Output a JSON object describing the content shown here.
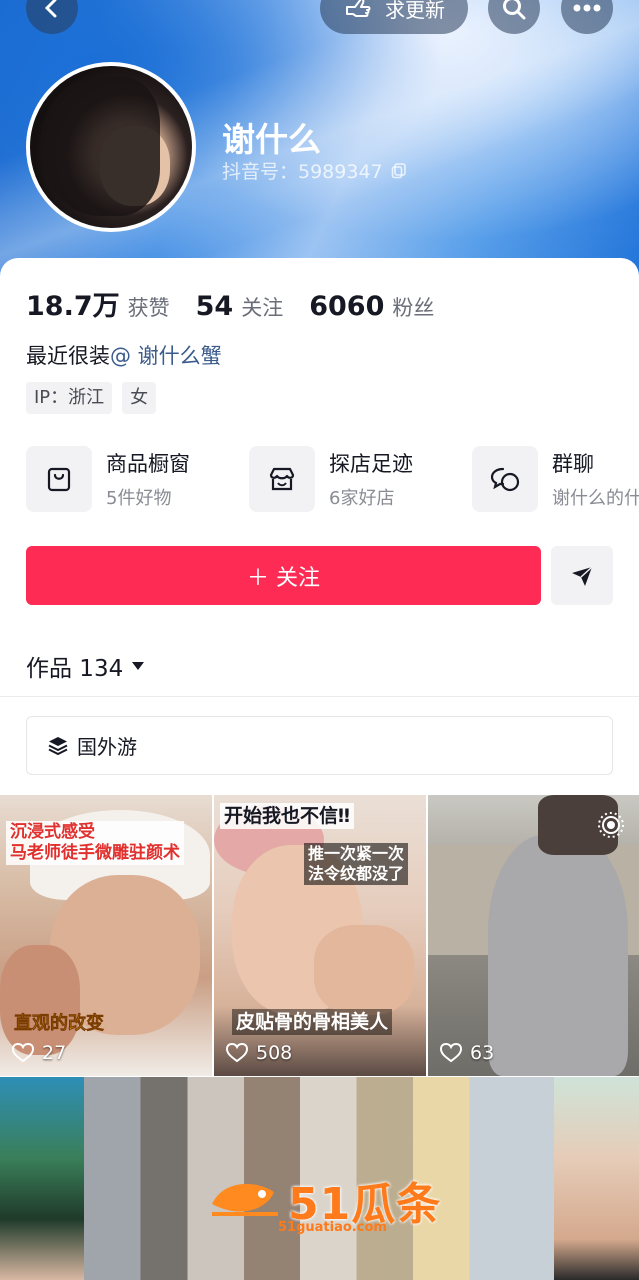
{
  "header": {
    "update_label": "求更新",
    "icons": [
      "back-arrow-icon",
      "hand-point-icon",
      "search-icon",
      "more-icon"
    ]
  },
  "profile": {
    "name": "谢什么",
    "douyin_id": "抖音号：5989347"
  },
  "stats": [
    {
      "value": "18.7万",
      "label": "获赞"
    },
    {
      "value": "54",
      "label": "关注"
    },
    {
      "value": "6060",
      "label": "粉丝"
    }
  ],
  "bio": {
    "text": "最近很装",
    "mention": "@ 谢什么蟹"
  },
  "tags": [
    "IP：浙江",
    "女"
  ],
  "features": [
    {
      "title": "商品橱窗",
      "subtitle": "5件好物"
    },
    {
      "title": "探店足迹",
      "subtitle": "6家好店"
    },
    {
      "title": "群聊",
      "subtitle": "谢什么的什"
    }
  ],
  "actions": {
    "follow_label": "＋ 关注"
  },
  "works": {
    "label": "作品 134"
  },
  "collection": {
    "label": "国外游"
  },
  "videos": [
    {
      "caption_top": "沉浸式感受\n马老师徒手微雕驻颜术",
      "caption_bottom": "直观的改变",
      "likes": "27"
    },
    {
      "caption_top": "开始我也不信‼",
      "caption_mid": "推一次紧一次\n法令纹都没了",
      "caption_bottom": "皮贴骨的骨相美人",
      "likes": "508"
    },
    {
      "likes": "63"
    }
  ],
  "watermark": {
    "brand": "51瓜条",
    "url": "51guatiao.com"
  },
  "colors": {
    "accent": "#fe2c55",
    "mention": "#3b5b8c",
    "header_blue": "#2a7ae0"
  }
}
